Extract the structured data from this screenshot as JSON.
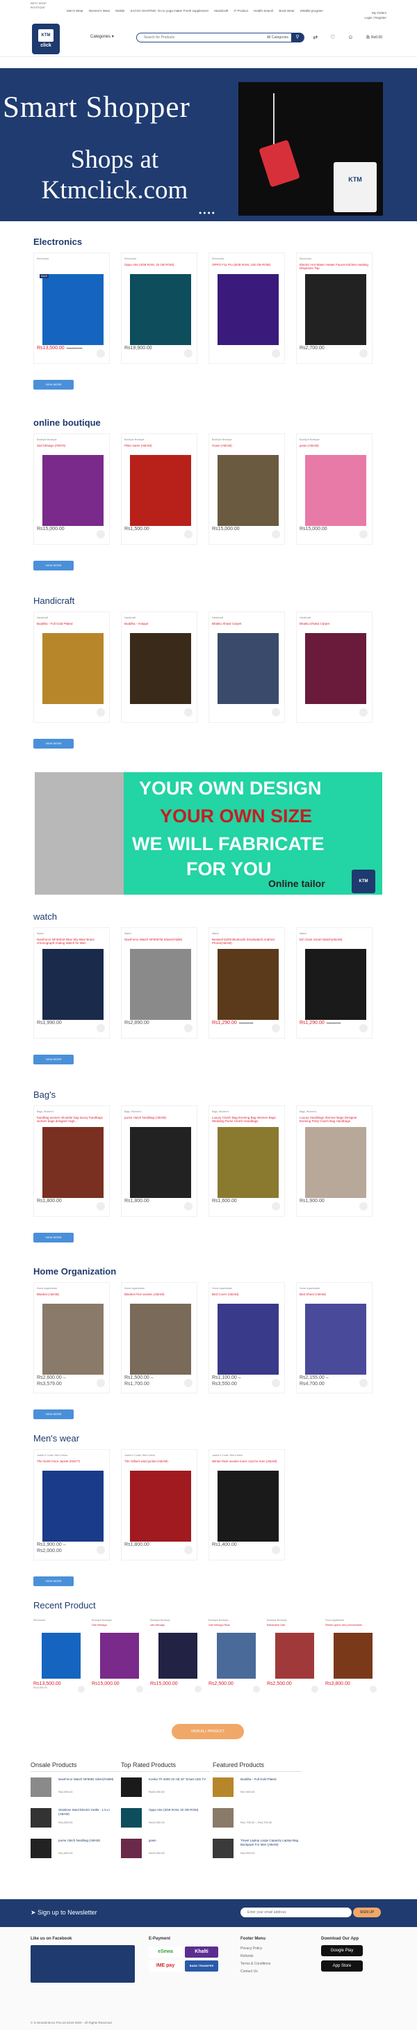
{
  "topbar": {
    "line1": "BEST SHOP",
    "line2": "BOUTIQUE",
    "nav": [
      "Men's Wear",
      "Women's Wear",
      "Mobile",
      "SACHA SHAPING: Go to yoga maker Fresh supplement",
      "Handicraft",
      "IT Product",
      "Health Search",
      "Book Wear",
      "eWallet program"
    ],
    "account": [
      "My Orders",
      "Login / Register"
    ]
  },
  "header": {
    "logo_text": "KTM",
    "logo_sub": "click",
    "categories_label": "Categories",
    "search_placeholder": "Search for Products",
    "all_categories": "All Categories",
    "cart_total": "Rs0.00",
    "cart_count": "0"
  },
  "hero": {
    "title": "Smart Shopper",
    "subtitle_line1": "Shops at",
    "subtitle_line2": "Ktmclick.com",
    "bag_label": "KTM",
    "dots": "●●●●"
  },
  "colors": {
    "brand": "#1e3a6e",
    "sale": "#dd2233",
    "accent": "#f0a868",
    "button": "#4a90d9",
    "promo": "#23d4a4"
  },
  "sections": [
    {
      "title": "Electronics",
      "products": [
        {
          "cat": "Electronics",
          "name": "",
          "price": "Rs13,500.00",
          "old": "Rs14,500.00",
          "sale": true,
          "color": "#1565c0"
        },
        {
          "cat": "Electronics",
          "name": "Oppo A5s (4GB RAM, 32 GB ROM)",
          "price": "Rs18,900.00",
          "old": "",
          "sale": false,
          "color": "#0d4d5c"
        },
        {
          "cat": "Electronics",
          "name": "OPPO F11 Pro (6GB RAM, 128 GB ROM)",
          "price": "",
          "old": "",
          "sale": false,
          "color": "#3a1a7a"
        },
        {
          "cat": "Electronics",
          "name": "Electric Hot Water Heater Faucet Kitchen Heating Dispenser Tap",
          "price": "Rs2,700.00",
          "old": "",
          "sale": false,
          "color": "#222222"
        }
      ],
      "view_more": "VIEW MORE"
    },
    {
      "title": "online boutique",
      "products": [
        {
          "cat": "Boutique Boutique",
          "name": "Sari kilinago (#2675)",
          "price": "Rs15,000.00",
          "old": "",
          "sale": false,
          "color": "#7a2a8a"
        },
        {
          "cat": "Boutique Boutique",
          "name": "Plain saree (ABAM)",
          "price": "Rs1,500.00",
          "old": "",
          "sale": false,
          "color": "#b8201a"
        },
        {
          "cat": "Boutique Boutique",
          "name": "Gown (ABAM)",
          "price": "Rs15,000.00",
          "old": "",
          "sale": false,
          "color": "#6a5a40"
        },
        {
          "cat": "Boutique Boutique",
          "name": "gown (ABAM)",
          "price": "Rs15,000.00",
          "old": "",
          "sale": false,
          "color": "#e87aa8"
        }
      ],
      "view_more": "VIEW MORE"
    },
    {
      "title": "Handicraft",
      "products": [
        {
          "cat": "Handicraft",
          "name": "Buddha - Full Gold Plated",
          "price": "",
          "old": "",
          "sale": false,
          "color": "#b8862a"
        },
        {
          "cat": "Handicraft",
          "name": "Buddha - Antique",
          "price": "",
          "old": "",
          "sale": false,
          "color": "#3a2a1a"
        },
        {
          "cat": "Handicraft",
          "name": "Bhaktu Shawl Carpet",
          "price": "",
          "old": "",
          "sale": false,
          "color": "#3a4a6a"
        },
        {
          "cat": "Handicraft",
          "name": "Bhaktu Dhaka Carpet",
          "price": "",
          "old": "",
          "sale": false,
          "color": "#6a1a3a"
        }
      ],
      "view_more": "VIEW MORE"
    }
  ],
  "promo": {
    "line1": "YOUR OWN DESIGN",
    "line2": "YOUR OWN SIZE",
    "line3": "WE WILL FABRICATE",
    "line4": "FOR YOU",
    "line5": "Online tailor",
    "bag_label": "KTM"
  },
  "sections2": [
    {
      "title": "watch",
      "products": [
        {
          "cat": "Watch",
          "name": "NaviForce NF3001E Blue Sky Blue Brass chronograph Analog Watch for Men",
          "price": "Rs1,990.00",
          "old": "",
          "color": "#1a2a4a"
        },
        {
          "cat": "Watch",
          "name": "NaviForce Watch NF9097M Silver(#ABM)",
          "price": "Rs2,890.00",
          "old": "",
          "color": "#8a8a8a"
        },
        {
          "cat": "Watch",
          "name": "Bestsell DZ09 Bluetooth Smartwatch Android Phone(ABAM)",
          "price": "Rs1,290.00",
          "old": "Rs1,890.00",
          "color": "#5a3a1a"
        },
        {
          "cat": "Watch",
          "name": "DZ Clock Smart Watch(ABAM)",
          "price": "Rs1,290.00",
          "old": "Rs2,890.00",
          "color": "#1a1a1a"
        }
      ],
      "view_more": "VIEW MORE"
    },
    {
      "title": "Bag's",
      "products": [
        {
          "cat": "Bags, Women's",
          "name": "handbag women shoulder bag luxury handbags women bags designer High...",
          "price": "Rs1,800.00",
          "old": "",
          "color": "#7a3020"
        },
        {
          "cat": "Bags, Women's",
          "name": "purse clutch handbag (ABAM)",
          "price": "Rs1,800.00",
          "old": "",
          "color": "#222222"
        },
        {
          "cat": "Bags, Women's",
          "name": "Luxury Clutch Bag Evening Bag Women Bags Wedding Purse Clutch Handbags",
          "price": "Rs1,600.00",
          "old": "",
          "color": "#8a7a30"
        },
        {
          "cat": "Bags, Women's",
          "name": "Luxury Handbags Women Bags Designer Evening Party Clutch Bag Handbags",
          "price": "Rs1,900.00",
          "old": "",
          "color": "#b8a89a"
        }
      ],
      "view_more": "VIEW MORE"
    },
    {
      "title": "Home Organization",
      "products": [
        {
          "cat": "Home organization",
          "name": "Blanket (ABAM)",
          "price": "Rs2,600.00 –",
          "price2": "Rs3,579.00",
          "old": "",
          "color": "#8a7a6a"
        },
        {
          "cat": "Home organization",
          "name": "Blanket Fine woolen (ABAM)",
          "price": "Rs1,500.00 –",
          "price2": "Rs1,700.00",
          "old": "",
          "color": "#7a6a5a"
        },
        {
          "cat": "Home organization",
          "name": "Bed Cover (ABAM)",
          "price": "Rs1,100.00 –",
          "price2": "Rs3,550.00",
          "old": "",
          "color": "#3a3a8a"
        },
        {
          "cat": "Home organization",
          "name": "Bed Sheet (ABAM)",
          "price": "Rs2,155.00 –",
          "price2": "Rs4,700.00",
          "old": "",
          "color": "#4a4a9a"
        }
      ],
      "view_more": "VIEW MORE"
    },
    {
      "title": "Men's wear",
      "products": [
        {
          "cat": "Jacket & Coats, Men's Wear",
          "name": "The North Face Jacket (#2677)",
          "price": "Rs1,900.00 –",
          "price2": "Rs2,000.00",
          "old": "",
          "color": "#1a3a8a"
        },
        {
          "cat": "Jacket & Coats, Men's Wear",
          "name": "The Gilbert wind jacket (ABAM)",
          "price": "Rs1,800.00",
          "price2": "",
          "old": "",
          "color": "#a01a20"
        },
        {
          "cat": "Jacket & Coats, Men's Wear",
          "name": "Winter thick woolen inner coat for men (ABAM)",
          "price": "Rs1,400.00",
          "price2": "",
          "old": "",
          "color": "#1a1a1a"
        }
      ],
      "view_more": "VIEW MORE"
    }
  ],
  "recent": {
    "title": "Recent Product",
    "products": [
      {
        "cat": "Electronics",
        "name": "",
        "price": "Rs13,500.00",
        "note": "Rs14,500.00",
        "color": "#1565c0"
      },
      {
        "cat": "Boutique Boutique",
        "name": "Sari kilinago",
        "price": "Rs15,000.00",
        "note": "",
        "color": "#7a2a8a"
      },
      {
        "cat": "Boutique Boutique",
        "name": "sari kilinago",
        "price": "Rs15,000.00",
        "note": "",
        "color": "#222244"
      },
      {
        "cat": "Boutique Boutique",
        "name": "Sari kilinago Blue",
        "price": "Rs2,500.00",
        "note": "",
        "color": "#4a6a9a"
      },
      {
        "cat": "Boutique Boutique",
        "name": "Banarashi Sari",
        "price": "Rs2,500.00",
        "note": "",
        "color": "#a03a3a"
      },
      {
        "cat": "Food supplement",
        "name": "Retain gums and peroxidases",
        "price": "Rs3,800.00",
        "note": "",
        "color": "#7a3a1a"
      }
    ],
    "view_all": "VIEW ALL PRODUCT"
  },
  "lists": [
    {
      "title": "Onsale Products",
      "items": [
        {
          "name": "NaviForce Watch NF9082 Silver(#ABM)",
          "price": "Rs2,890.00",
          "color": "#8a8a8a"
        },
        {
          "name": "Stainless Steel Electric Kettle - 1.5 Lt (ABAM)",
          "price": "Rs1,800.00",
          "color": "#333333"
        },
        {
          "name": "purse clutch handbag (ABAM)",
          "price": "Rs1,800.00",
          "color": "#222222"
        }
      ]
    },
    {
      "title": "Top Rated Products",
      "items": [
        {
          "name": "Konka TF-4000 32 Hd 32\" Smart LED TV",
          "price": "Rs30,000.00",
          "color": "#1a1a1a"
        },
        {
          "name": "Oppo A5s (3GB RAM, 32 GB ROM)",
          "price": "Rs19,000.00",
          "color": "#0d4d5c"
        },
        {
          "name": "gown",
          "price": "Rs15,000.00",
          "color": "#6a2a4a"
        }
      ]
    },
    {
      "title": "Featured Products",
      "items": [
        {
          "name": "Buddha - Full Gold Plated",
          "price": "Rs7,500.00",
          "color": "#b8862a"
        },
        {
          "name": "",
          "price": "Rs1,700.00 – Rs3,700.00",
          "color": "#8a7a6a"
        },
        {
          "name": "Travel Laptop Large Capacity Laptop Bag Backpack For Men (ABAM)",
          "price": "Rs2,500.00",
          "color": "#3a3a3a"
        }
      ]
    }
  ],
  "newsletter": {
    "label": "Sign up to Newsletter",
    "placeholder": "Enter your email address",
    "button": "SIGN UP"
  },
  "footer": {
    "facebook_title": "Like us on Facebook",
    "payment_title": "E-Payment",
    "payments": [
      {
        "label": "eSewa",
        "bg": "#ffffff",
        "fg": "#3aa33a"
      },
      {
        "label": "Khalti",
        "bg": "#5c2d91",
        "fg": "#ffffff"
      },
      {
        "label": "IME pay",
        "bg": "#ffffff",
        "fg": "#d22a2a"
      },
      {
        "label": "BANK TRANSFER",
        "bg": "#2a5aa8",
        "fg": "#ffffff"
      }
    ],
    "menu_title": "Footer Menu",
    "menu": [
      "Privacy Policy",
      "Refunds",
      "Terms & Conditions",
      "Contact Us"
    ],
    "app_title": "Download Our App",
    "stores": [
      "Google Play",
      "App Store"
    ],
    "copyright": "© S-Wonderlence Pvt.Ltd 2019-2020 - All Rights Reserved"
  }
}
